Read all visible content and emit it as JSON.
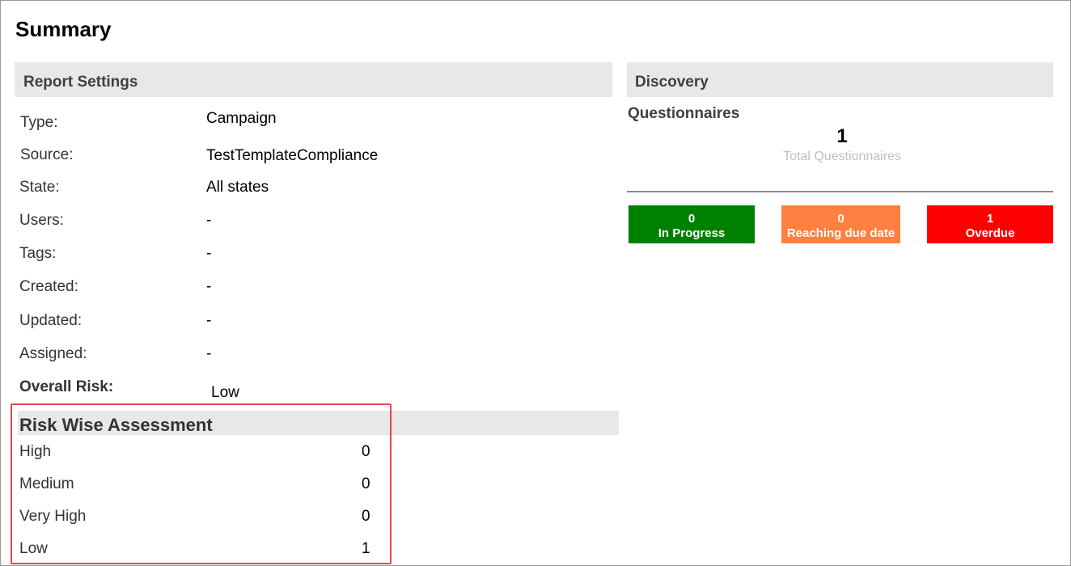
{
  "page_title": "Summary",
  "report_settings": {
    "header": "Report Settings",
    "rows": [
      {
        "label": "Type:",
        "value": "Campaign"
      },
      {
        "label": "Source:",
        "value": "TestTemplateCompliance"
      },
      {
        "label": "State:",
        "value": "All states"
      },
      {
        "label": "Users:",
        "value": "-"
      },
      {
        "label": "Tags:",
        "value": "-"
      },
      {
        "label": "Created:",
        "value": "-"
      },
      {
        "label": "Updated:",
        "value": "-"
      },
      {
        "label": "Assigned:",
        "value": "-"
      }
    ],
    "overall_risk_label": "Overall Risk:",
    "overall_risk_value": "Low"
  },
  "risk_wise_assessment": {
    "header": "Risk Wise Assessment",
    "rows": [
      {
        "label": "High",
        "value": "0"
      },
      {
        "label": "Medium",
        "value": "0"
      },
      {
        "label": "Very High",
        "value": "0"
      },
      {
        "label": "Low",
        "value": "1"
      }
    ]
  },
  "discovery": {
    "header": "Discovery",
    "questionnaires_title": "Questionnaires",
    "total_count": "1",
    "total_label": "Total Questionnaires",
    "stats": [
      {
        "value": "0",
        "label": "In Progress",
        "color": "#008000"
      },
      {
        "value": "0",
        "label": "Reaching due date",
        "color": "#ff8040"
      },
      {
        "value": "1",
        "label": "Overdue",
        "color": "#ff0000"
      }
    ]
  },
  "colors": {
    "section_header_bg": "#e8e8e8",
    "highlight_border": "#e5464a"
  }
}
